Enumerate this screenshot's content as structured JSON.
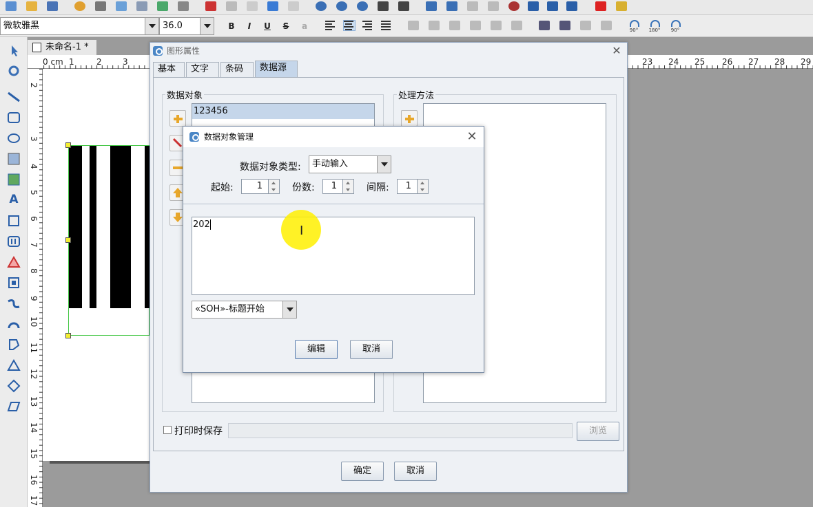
{
  "toolbar": {
    "font_name": "微软雅黑",
    "font_size": "36.0",
    "bold": "B",
    "italic": "I",
    "underline": "U",
    "strike": "S",
    "rotate_labels": [
      "90°",
      "180°",
      "90°"
    ]
  },
  "document": {
    "tab_title": "未命名-1 *"
  },
  "ruler": {
    "top_unit": "0 cm",
    "top_left_numbers": [
      "1",
      "2",
      "3"
    ],
    "top_right_numbers": [
      "23",
      "24",
      "25",
      "26",
      "27",
      "28",
      "29"
    ],
    "left_numbers": [
      "2",
      "3",
      "4",
      "5",
      "6",
      "7",
      "8",
      "9",
      "10",
      "11",
      "12",
      "13",
      "14",
      "15",
      "16",
      "17"
    ]
  },
  "props_dialog": {
    "title": "图形属性",
    "tabs": [
      "基本",
      "文字",
      "条码",
      "数据源"
    ],
    "active_tab": "数据源",
    "data_objects_label": "数据对象",
    "data_objects": [
      "123456"
    ],
    "process_label": "处理方法",
    "save_on_print_label": "打印时保存",
    "browse_label": "浏览",
    "ok_label": "确定",
    "cancel_label": "取消"
  },
  "dom_dialog": {
    "title": "数据对象管理",
    "type_label": "数据对象类型:",
    "type_value": "手动输入",
    "start_label": "起始:",
    "start_value": "1",
    "copies_label": "份数:",
    "copies_value": "1",
    "interval_label": "间隔:",
    "interval_value": "1",
    "content": "202",
    "control_char": "«SOH»-标题开始",
    "edit_label": "编辑",
    "cancel_label": "取消"
  },
  "colors": {
    "accent": "#4a86c6",
    "selection": "#c5d6ea",
    "highlight": "#fff000"
  }
}
